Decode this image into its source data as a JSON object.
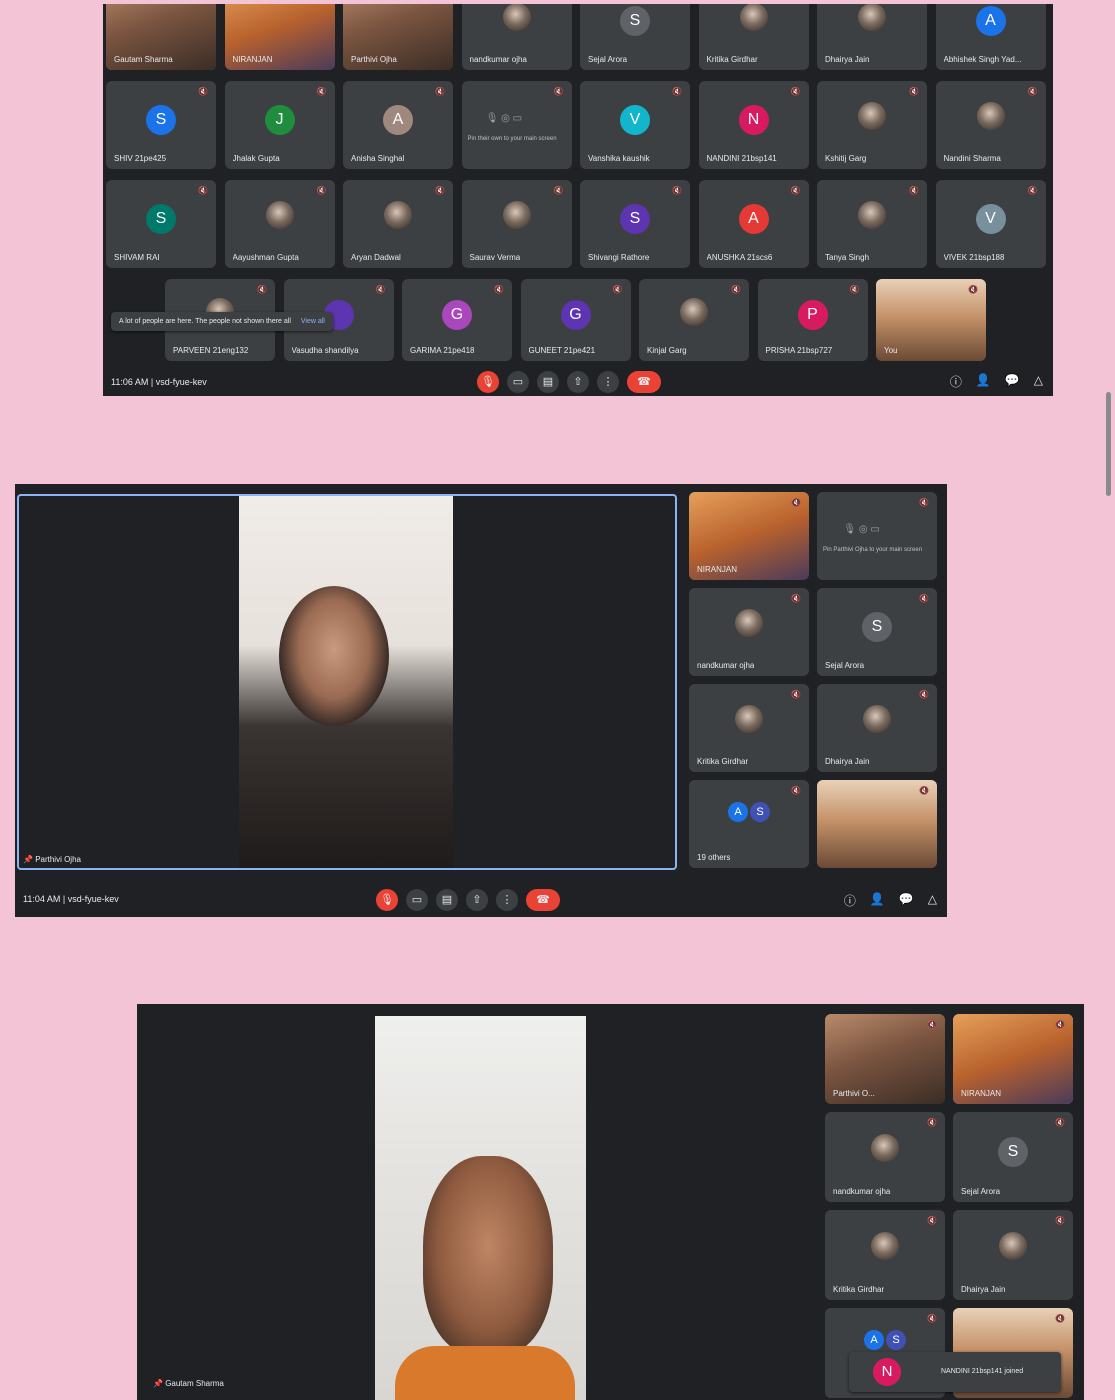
{
  "meetings": [
    {
      "time": "11:06 AM",
      "code": "vsd-fyue-kev",
      "grid": [
        {
          "name": "Gautam Sharma",
          "kind": "video",
          "active": true
        },
        {
          "name": "NIRANJAN",
          "kind": "video-orange"
        },
        {
          "name": "Parthivi Ojha",
          "kind": "video"
        },
        {
          "name": "nandkumar ojha",
          "kind": "photo"
        },
        {
          "name": "Sejal Arora",
          "kind": "avatar",
          "letter": "S",
          "color": "#5f6368"
        },
        {
          "name": "Kritika Girdhar",
          "kind": "photo"
        },
        {
          "name": "Dhairya Jain",
          "kind": "photo"
        },
        {
          "name": "Abhishek Singh Yad...",
          "kind": "avatar",
          "letter": "A",
          "color": "#1a73e8"
        },
        {
          "name": "SHIV 21pe425",
          "kind": "avatar",
          "letter": "S",
          "color": "#1a73e8"
        },
        {
          "name": "Jhalak Gupta",
          "kind": "avatar",
          "letter": "J",
          "color": "#1e8e3e"
        },
        {
          "name": "Anisha Singhal",
          "kind": "avatar",
          "letter": "A",
          "color": "#a1887f"
        },
        {
          "name": "",
          "kind": "pinned"
        },
        {
          "name": "Vanshika kaushik",
          "kind": "avatar",
          "letter": "V",
          "color": "#12b5cb"
        },
        {
          "name": "NANDINI 21bsp141",
          "kind": "avatar",
          "letter": "N",
          "color": "#d81b60"
        },
        {
          "name": "Kshitij Garg",
          "kind": "photo"
        },
        {
          "name": "Nandini Sharma",
          "kind": "photo"
        },
        {
          "name": "SHIVAM RAI",
          "kind": "avatar",
          "letter": "S",
          "color": "#00796b"
        },
        {
          "name": "Aayushman Gupta",
          "kind": "photo"
        },
        {
          "name": "Aryan Dadwal",
          "kind": "photo"
        },
        {
          "name": "Saurav Verma",
          "kind": "photo"
        },
        {
          "name": "Shivangi Rathore",
          "kind": "avatar",
          "letter": "S",
          "color": "#5e35b1"
        },
        {
          "name": "ANUSHKA 21scs6",
          "kind": "avatar",
          "letter": "A",
          "color": "#e53935"
        },
        {
          "name": "Tanya Singh",
          "kind": "photo"
        },
        {
          "name": "VIVEK 21bsp188",
          "kind": "avatar",
          "letter": "V",
          "color": "#78909c"
        }
      ],
      "last_row": [
        {
          "name": "PARVEEN 21eng132",
          "kind": "photo"
        },
        {
          "name": "Vasudha shandilya",
          "kind": "avatar",
          "letter": "",
          "color": "#5e35b1"
        },
        {
          "name": "GARIMA 21pe418",
          "kind": "avatar",
          "letter": "G",
          "color": "#ab47bc"
        },
        {
          "name": "GUNEET 21pe421",
          "kind": "avatar",
          "letter": "G",
          "color": "#5e35b1"
        },
        {
          "name": "Kinjal Garg",
          "kind": "photo"
        },
        {
          "name": "PRISHA 21bsp727",
          "kind": "avatar",
          "letter": "P",
          "color": "#d81b60"
        },
        {
          "name": "You",
          "kind": "video-room"
        }
      ],
      "toast": {
        "text": "A lot of people are here. The people not shown there all",
        "link": "View all"
      },
      "pinned_hint": "Pin their own to your main screen",
      "buttons": {
        "mic": "🎙",
        "cam": "▭",
        "cc": "▤",
        "present": "⇧",
        "more": "⋮",
        "end": "☎",
        "info": "ⓘ",
        "people": "👤",
        "chat": "💬",
        "activities": "△"
      }
    },
    {
      "time": "11:04 AM",
      "code": "vsd-fyue-kev",
      "speaker": "Parthivi Ojha",
      "side": [
        {
          "name": "NIRANJAN",
          "kind": "video-orange"
        },
        {
          "name": "",
          "kind": "pinned",
          "hint": "Pin Parthivi Ojha to your main screen"
        },
        {
          "name": "nandkumar ojha",
          "kind": "photo"
        },
        {
          "name": "Sejal Arora",
          "kind": "avatar",
          "letter": "S",
          "color": "#5f6368"
        },
        {
          "name": "Kritika Girdhar",
          "kind": "photo"
        },
        {
          "name": "Dhairya Jain",
          "kind": "photo"
        },
        {
          "name": "19 others",
          "kind": "others",
          "letters": [
            "A",
            "S"
          ]
        },
        {
          "name": "",
          "kind": "video-room"
        }
      ]
    },
    {
      "speaker": "Gautam Sharma",
      "side": [
        {
          "name": "Parthivi O...",
          "kind": "video"
        },
        {
          "name": "NIRANJAN",
          "kind": "video-orange",
          "active": true
        },
        {
          "name": "nandkumar ojha",
          "kind": "photo"
        },
        {
          "name": "Sejal Arora",
          "kind": "avatar",
          "letter": "S",
          "color": "#5f6368"
        },
        {
          "name": "Kritika Girdhar",
          "kind": "photo"
        },
        {
          "name": "Dhairya Jain",
          "kind": "photo"
        },
        {
          "name": "",
          "kind": "others",
          "letters": [
            "A",
            "S"
          ]
        },
        {
          "name": "",
          "kind": "video-room"
        }
      ],
      "join_toast": {
        "letter": "N",
        "text": "NANDINI 21bsp141 joined"
      }
    }
  ]
}
